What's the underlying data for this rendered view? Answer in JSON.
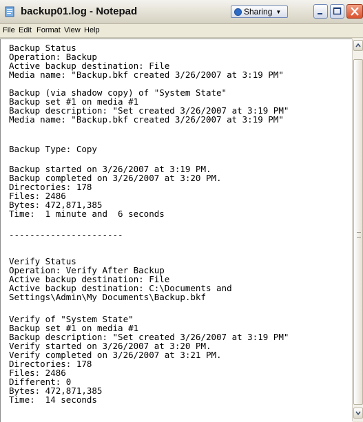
{
  "window": {
    "title": "backup01.log - Notepad"
  },
  "sharing": {
    "label": "Sharing"
  },
  "menu": [
    "File",
    "Edit",
    "Format",
    "View",
    "Help"
  ],
  "lines": [
    "Backup Status",
    "Operation: Backup",
    "Active backup destination: File",
    "Media name: \"Backup.bkf created 3/26/2007 at 3:19 PM\"",
    "",
    "Backup (via shadow copy) of \"System State\"",
    "Backup set #1 on media #1",
    "Backup description: \"Set created 3/26/2007 at 3:19 PM\"",
    "Media name: \"Backup.bkf created 3/26/2007 at 3:19 PM\"",
    "",
    "Backup Type: Copy",
    "",
    "Backup started on 3/26/2007 at 3:19 PM.",
    "Backup completed on 3/26/2007 at 3:20 PM.",
    "Directories: 178",
    "Files: 2486",
    "Bytes: 472,871,385",
    "Time:  1 minute and  6 seconds",
    "",
    "----------------------",
    "",
    "Verify Status",
    "Operation: Verify After Backup",
    "Active backup destination: File",
    "Active backup destination: C:\\Documents and",
    "Settings\\Admin\\My Documents\\Backup.bkf",
    "",
    "Verify of \"System State\"",
    "Backup set #1 on media #1",
    "Backup description: \"Set created 3/26/2007 at 3:19 PM\"",
    "Verify started on 3/26/2007 at 3:20 PM.",
    "Verify completed on 3/26/2007 at 3:21 PM.",
    "Directories: 178",
    "Files: 2486",
    "Different: 0",
    "Bytes: 472,871,385",
    "Time:  14 seconds"
  ]
}
